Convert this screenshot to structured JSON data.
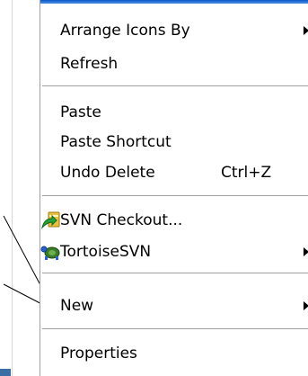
{
  "menu": {
    "items": [
      {
        "label": "Arrange Icons By",
        "submenu": true
      },
      {
        "label": "Refresh"
      },
      {
        "label": "Paste"
      },
      {
        "label": "Paste Shortcut"
      },
      {
        "label": "Undo Delete",
        "shortcut": "Ctrl+Z"
      },
      {
        "label": "SVN Checkout...",
        "icon": "svn-checkout-icon"
      },
      {
        "label": "TortoiseSVN",
        "icon": "tortoisesvn-icon",
        "submenu": true
      },
      {
        "label": "New",
        "submenu": true
      },
      {
        "label": "Properties"
      }
    ]
  },
  "colors": {
    "menu_border": "#a0a0a0",
    "title_blue": "#0a58c8",
    "taskbar_blue": "#3a6ea5"
  }
}
